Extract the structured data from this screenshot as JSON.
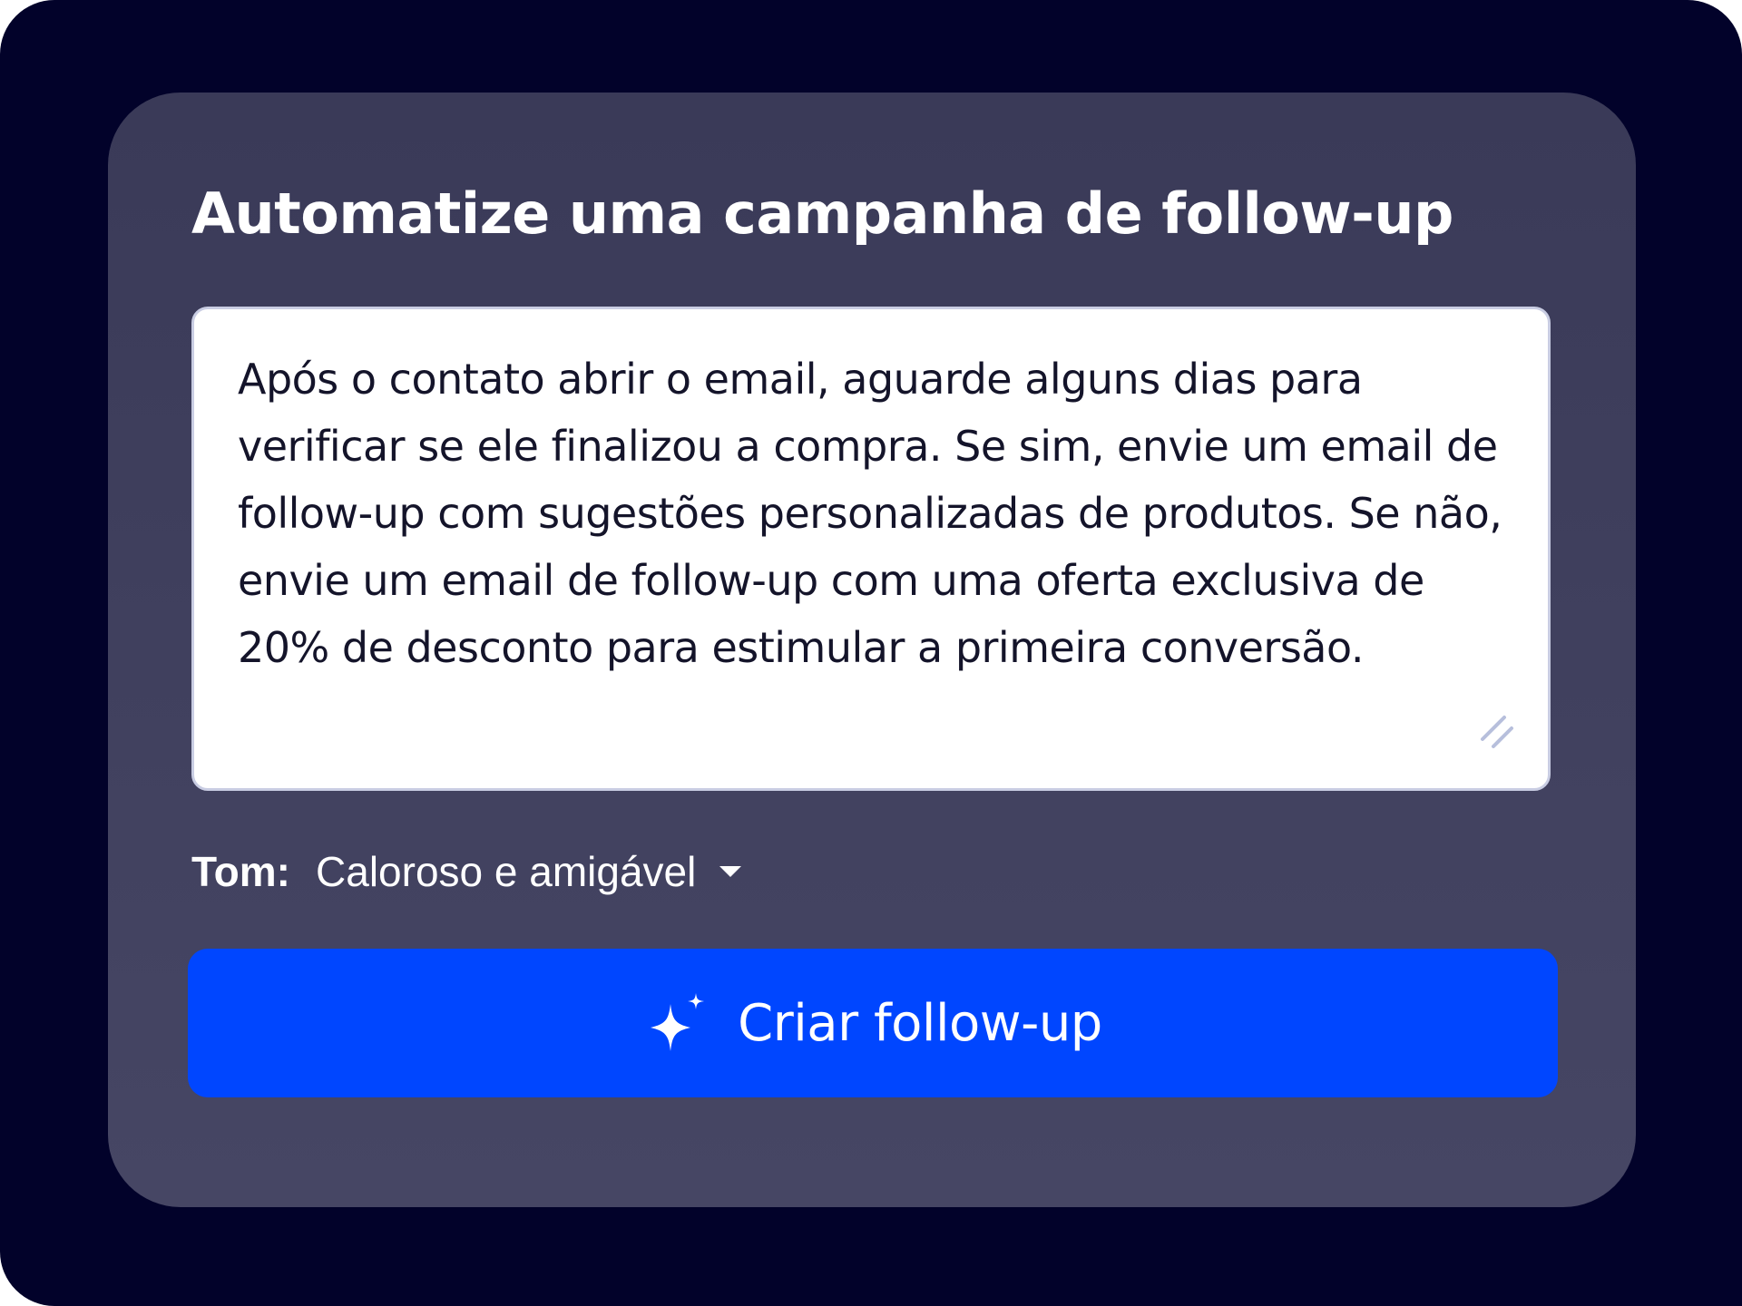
{
  "card": {
    "title": "Automatize uma campanha de follow-up",
    "prompt": {
      "value": "Após o contato abrir o email, aguarde alguns dias para verificar se ele finalizou a compra. Se sim, envie um email de follow-up com sugestões personalizadas de produtos. Se não, envie um email de follow-up com uma oferta exclusiva de 20% de desconto para estimular a primeira conversão."
    },
    "tone": {
      "label": "Tom:",
      "selected": "Caloroso e amigável",
      "icon": "chevron-down-icon"
    },
    "create_button": {
      "label": "Criar follow-up",
      "icon": "sparkle-icon"
    }
  },
  "colors": {
    "background": "#02022a",
    "card": "#3f3f5e",
    "primary_button": "#0046ff",
    "text_light": "#ffffff",
    "text_dark": "#14142a"
  }
}
